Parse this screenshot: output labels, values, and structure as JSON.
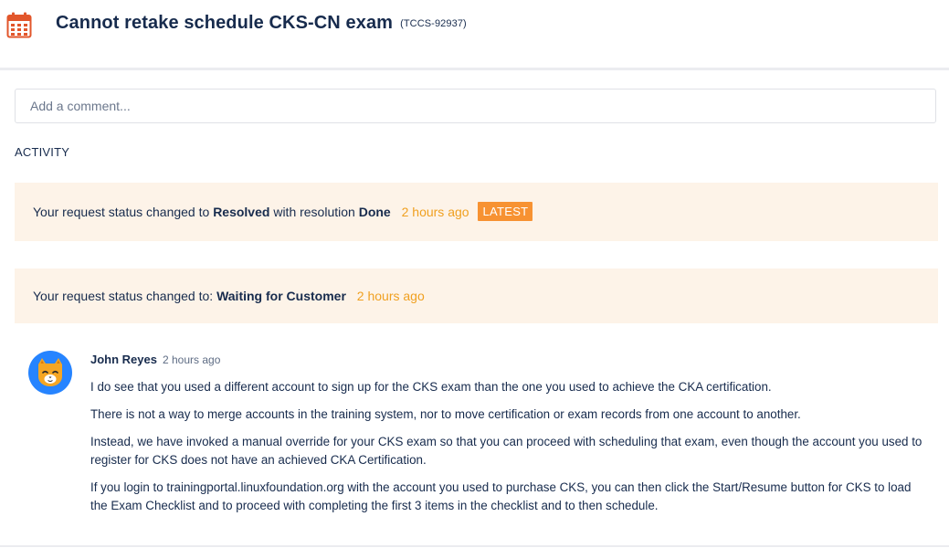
{
  "header": {
    "title": "Cannot retake schedule CKS-CN exam",
    "ticket_id": "(TCCS-92937)",
    "icon": "calendar-icon",
    "icon_color": "#e2562b"
  },
  "comment_input": {
    "placeholder": "Add a comment..."
  },
  "activity": {
    "label": "ACTIVITY",
    "events": [
      {
        "prefix": "Your request status changed to ",
        "status": "Resolved",
        "middle": " with resolution ",
        "resolution": "Done",
        "time": "2 hours ago",
        "badge": "LATEST"
      },
      {
        "prefix": "Your request status changed to: ",
        "status": "Waiting for Customer",
        "time": "2 hours ago"
      }
    ],
    "comment": {
      "author": "John Reyes",
      "time": "2 hours ago",
      "avatar": "cat-avatar-icon",
      "paragraphs": [
        "I do see that you used a different account to sign up for the CKS exam than the one you used to achieve the CKA certification.",
        "There is not a way to merge accounts in the training system, nor to move certification or exam records from one account to another.",
        "Instead, we have invoked a manual override for your CKS exam so that you can proceed with scheduling that exam, even though the account you used to register for CKS does not have an achieved CKA Certification.",
        "If you login to trainingportal.linuxfoundation.org with the account you used to purchase CKS, you can then click the Start/Resume button for CKS to load the Exam Checklist and to proceed with completing the first 3 items in the checklist and to then schedule."
      ]
    }
  },
  "colors": {
    "card_bg": "#fdf3e8",
    "time_link": "#f0a020",
    "badge_bg": "#f79232",
    "avatar_bg": "#2684ff"
  }
}
